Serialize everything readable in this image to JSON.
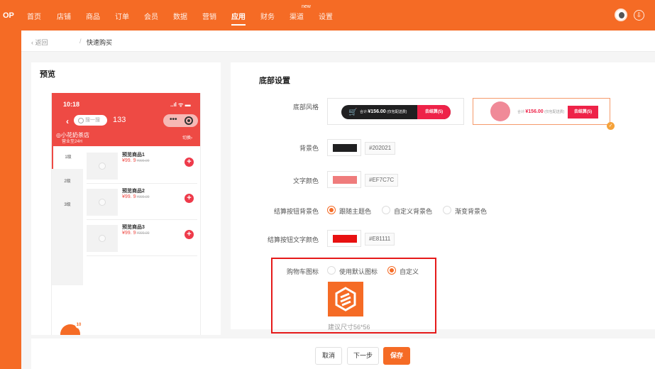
{
  "logo": "OP",
  "nav": {
    "items": [
      "首页",
      "店铺",
      "商品",
      "订单",
      "会员",
      "数据",
      "营销",
      "应用",
      "财务",
      "渠道",
      "设置"
    ],
    "active": "应用",
    "new_badge": "new",
    "help_icon": "download-icon"
  },
  "breadcrumb": {
    "back": "返回",
    "sep": "/",
    "current": "快速购买"
  },
  "preview": {
    "title": "预览",
    "phone": {
      "time": "10:18",
      "status": "..ıl ᯤ ▬",
      "search_placeholder": "搜一搜",
      "count": "133",
      "store_name": "小花奶茶店",
      "store_hours": "营业至24H",
      "switch_label": "切换",
      "categories": [
        "1级",
        "2级",
        "3级"
      ],
      "products": [
        {
          "name": "预览商品1",
          "price": "¥99. 9",
          "original_price": "¥999.99"
        },
        {
          "name": "预览商品2",
          "price": "¥99. 9",
          "original_price": "¥999.99"
        },
        {
          "name": "预览商品3",
          "price": "¥99. 9",
          "original_price": "¥999.99"
        }
      ],
      "cart_badge": "10"
    }
  },
  "settings": {
    "title": "底部设置",
    "bottom_style_label": "底部风格",
    "style_dark": {
      "total_prefix": "合计:",
      "total": "¥156.00",
      "fee_note": "(仅包配送费)",
      "checkout": "去结算(5)"
    },
    "style_light": {
      "total_prefix": "合计:",
      "total": "¥156.00",
      "fee_note": "(仅包配送费)",
      "checkout": "去结算(5)"
    },
    "bg_color_label": "背景色",
    "bg_color": "#202021",
    "text_color_label": "文字颜色",
    "text_color": "#EF7C7C",
    "checkout_bg_label": "结算按钮背景色",
    "checkout_bg_options": [
      "跟随主题色",
      "自定义背景色",
      "渐变背景色"
    ],
    "checkout_bg_selected": 0,
    "checkout_text_color_label": "结算按钮文字颜色",
    "checkout_text_color": "#E81111",
    "cart_icon_label": "购物车图标",
    "cart_icon_options": [
      "使用默认图标",
      "自定义"
    ],
    "cart_icon_selected": 1,
    "size_hint": "建议尺寸56*56"
  },
  "footer": {
    "cancel": "取消",
    "next": "下一步",
    "save": "保存"
  },
  "colors": {
    "brand": "#f56b25",
    "phone_header": "#ee4a44",
    "checkout": "#ee2248",
    "highlight_border": "#e51a1a"
  }
}
